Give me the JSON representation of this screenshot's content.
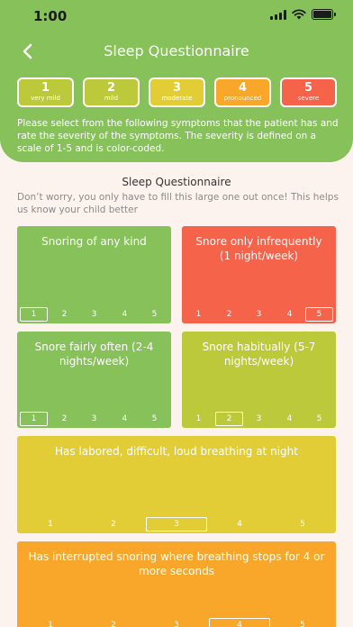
{
  "status_bar": {
    "time": "1:00"
  },
  "header": {
    "title": "Sleep Questionnaire",
    "scale": [
      {
        "num": "1",
        "label": "very mild",
        "color": "#bcc93a"
      },
      {
        "num": "2",
        "label": "mild",
        "color": "#bcc93a"
      },
      {
        "num": "3",
        "label": "moderate",
        "color": "#e3cd37"
      },
      {
        "num": "4",
        "label": "pronounced",
        "color": "#f8a72a"
      },
      {
        "num": "5",
        "label": "severe",
        "color": "#f5634a"
      }
    ],
    "intro": "Please select from the following symptoms that the patient has and rate the severity of the symptoms. The severity is defined on a scale of 1-5 and is color-coded."
  },
  "section": {
    "title": "Sleep Questionnaire",
    "subtitle": "Don’t worry, you only have to fill this large one out once! This helps us know your child better"
  },
  "questions": [
    {
      "text": "Snoring of any kind",
      "selected": 1,
      "color": "#86c15a",
      "options": [
        "1",
        "2",
        "3",
        "4",
        "5"
      ]
    },
    {
      "text": "Snore only infrequently (1 night/week)",
      "selected": 5,
      "color": "#f5634a",
      "options": [
        "1",
        "2",
        "3",
        "4",
        "5"
      ]
    },
    {
      "text": "Snore fairly often (2-4 nights/week)",
      "selected": 1,
      "color": "#86c15a",
      "options": [
        "1",
        "2",
        "3",
        "4",
        "5"
      ]
    },
    {
      "text": "Snore habitually (5-7 nights/week)",
      "selected": 2,
      "color": "#bcc93a",
      "options": [
        "1",
        "2",
        "3",
        "4",
        "5"
      ]
    },
    {
      "text": "Has labored, difficult, loud breathing at night",
      "selected": 3,
      "color": "#e3cd37",
      "options": [
        "1",
        "2",
        "3",
        "4",
        "5"
      ]
    },
    {
      "text": "Has interrupted snoring where breathing stops for 4 or more seconds",
      "selected": 4,
      "color": "#f8a72a",
      "options": [
        "1",
        "2",
        "3",
        "4",
        "5"
      ]
    }
  ]
}
